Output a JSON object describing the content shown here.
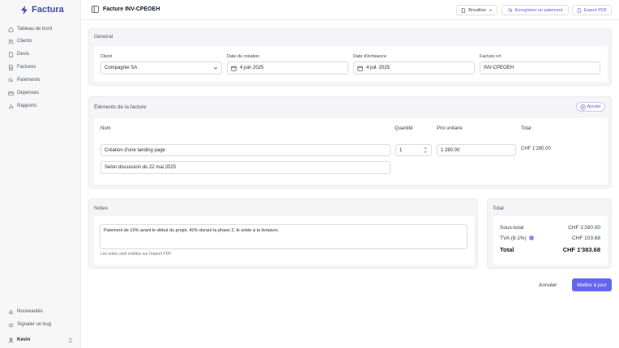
{
  "app": {
    "name": "Factura"
  },
  "sidebar": {
    "items": [
      {
        "label": "Tableau de bord",
        "icon": "home-icon"
      },
      {
        "label": "Clients",
        "icon": "users-icon"
      },
      {
        "label": "Devis",
        "icon": "file-icon"
      },
      {
        "label": "Factures",
        "icon": "file-text-icon"
      },
      {
        "label": "Paiements",
        "icon": "coins-icon"
      },
      {
        "label": "Dépenses",
        "icon": "wallet-icon"
      },
      {
        "label": "Rapports",
        "icon": "bar-chart-icon"
      }
    ],
    "bottom": [
      {
        "label": "Nouveautés",
        "icon": "bell-icon"
      },
      {
        "label": "Signaler un bug",
        "icon": "bug-icon"
      }
    ],
    "user": {
      "name": "Kevin"
    }
  },
  "header": {
    "title": "Facture INV-CPEOEH",
    "status": "Brouillon",
    "payment_button": "Enregistrer un paiement",
    "export_button": "Export PDF"
  },
  "general": {
    "title": "Général",
    "client_label": "Client",
    "client_value": "Compagnie SA",
    "created_label": "Date de création",
    "created_value": "4 juin 2025",
    "due_label": "Date d'échéance",
    "due_value": "4 juil. 2025",
    "number_label": "Facture n#",
    "number_value": "INV-CPEOEH"
  },
  "items": {
    "title": "Éléments de la facture",
    "add_button": "Ajouter",
    "columns": {
      "name": "Nom",
      "qty": "Quantité",
      "price": "Prix unitaire",
      "total": "Total"
    },
    "rows": [
      {
        "name": "Création d'une landing page",
        "qty": "1",
        "price": "1 280.00",
        "total": "CHF 1'280.00",
        "description": "Selon discussion du 22 mai 2025"
      }
    ]
  },
  "notes": {
    "title": "Notes",
    "value": "Paiement de 10% avant le début du projet, 40% durant la phase 2, le solde à la livraison.",
    "hint": "Les notes sont visibles sur l'export PDF"
  },
  "totals": {
    "title": "Total",
    "subtotal_label": "Sous-total",
    "subtotal_value": "CHF 1'280.00",
    "vat_label": "TVA (8.1%)",
    "vat_value": "CHF 103.68",
    "total_label": "Total",
    "total_value": "CHF 1'383.68"
  },
  "actions": {
    "cancel": "Annuler",
    "submit": "Mettre à jour"
  },
  "colors": {
    "accent": "#6366f1",
    "brand": "#3d4ba8"
  }
}
